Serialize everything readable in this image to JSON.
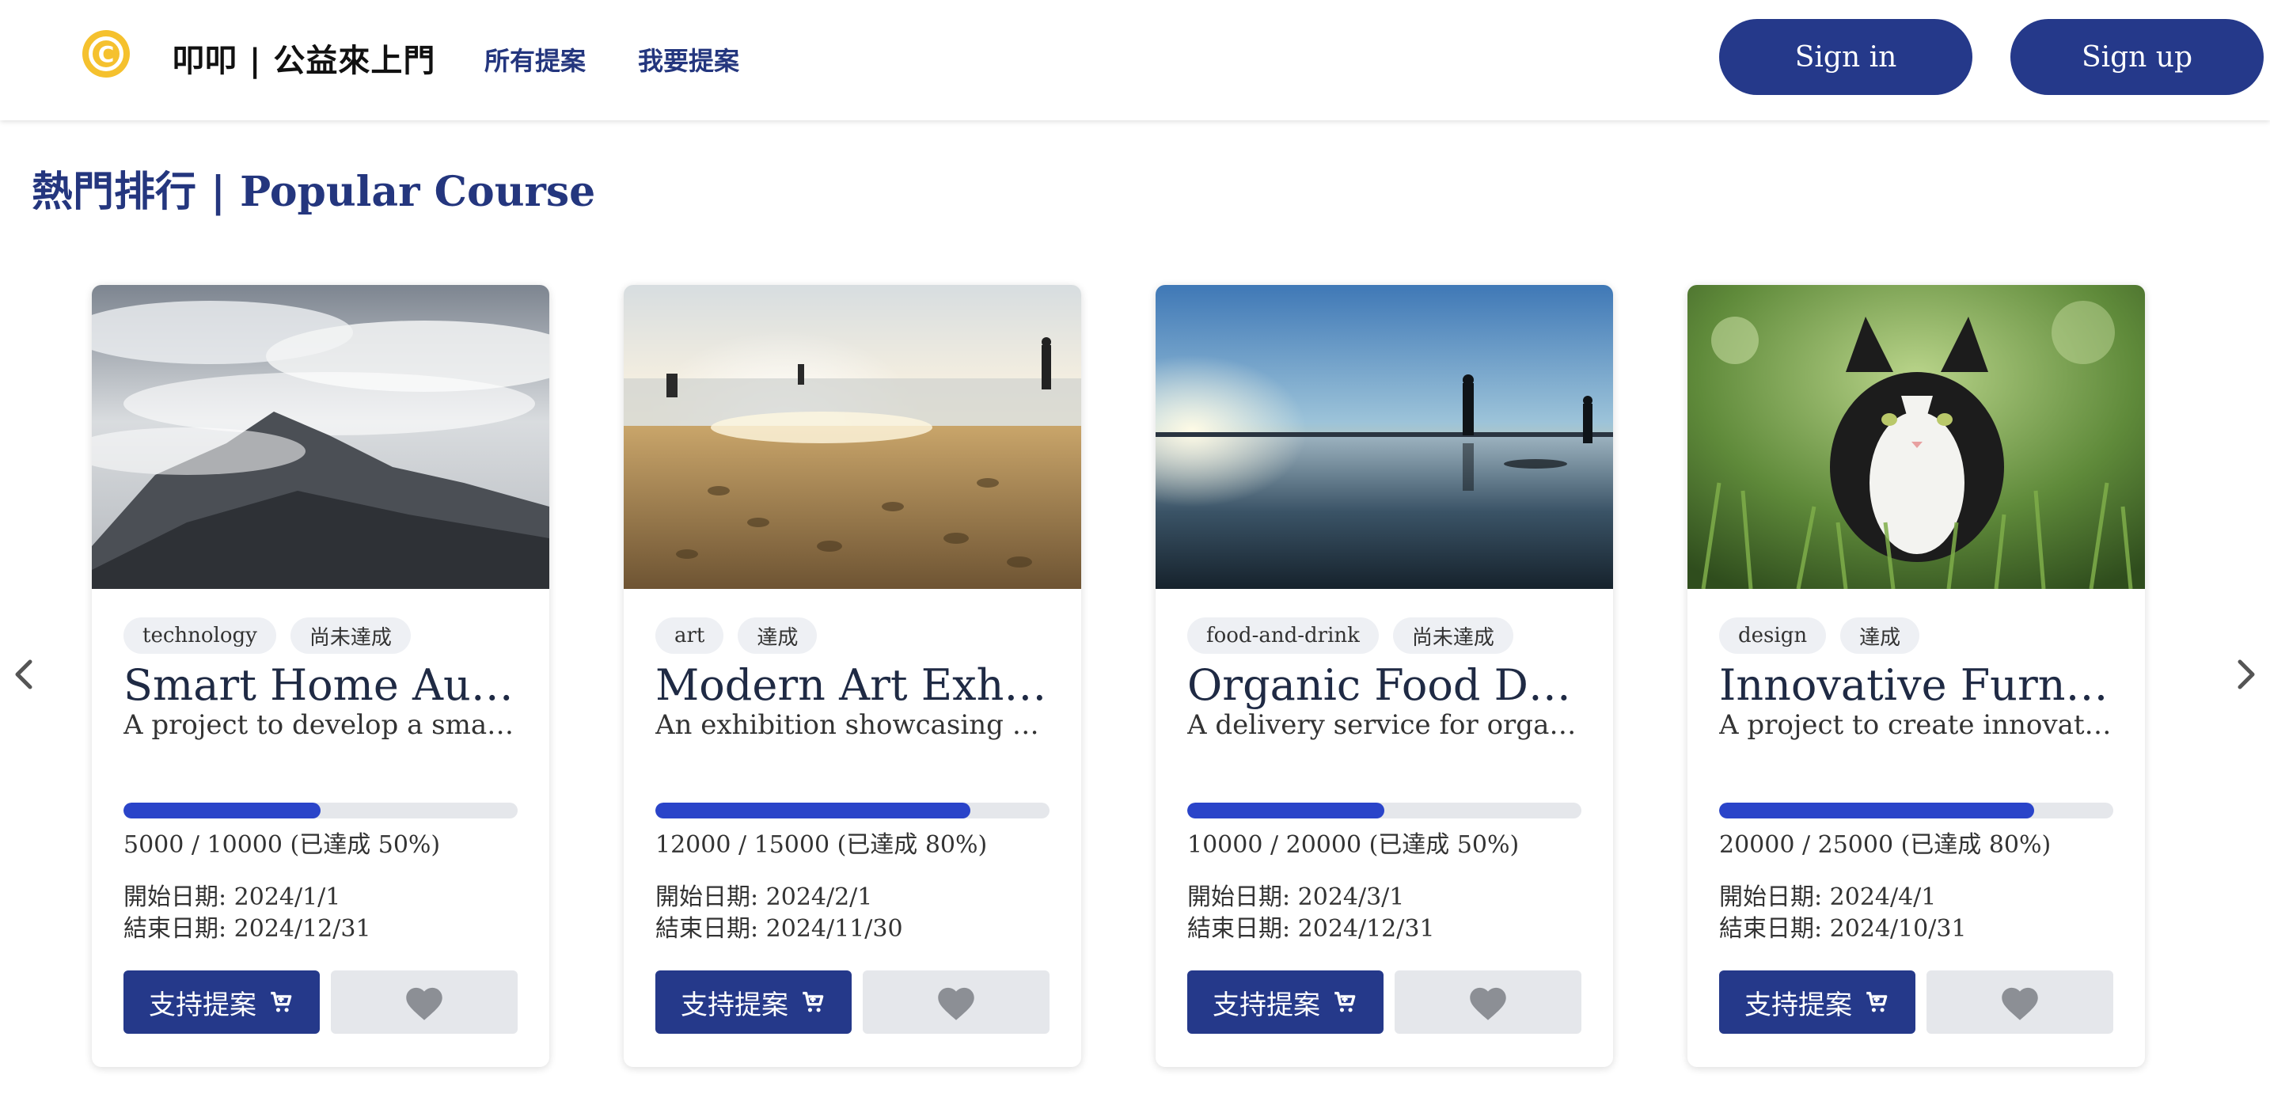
{
  "header": {
    "brand": "叩叩 | 公益來上門",
    "nav": [
      "所有提案",
      "我要提案"
    ],
    "sign_in": "Sign in",
    "sign_up": "Sign up",
    "logo_icon": "copyright-coin-icon",
    "logo_letter": "C"
  },
  "section": {
    "title": "熱門排行 | Popular Course"
  },
  "colors": {
    "primary": "#25398a",
    "progress": "#2a44c9",
    "logo": "#f5c12e",
    "fav": "#e5e7eb"
  },
  "cards": [
    {
      "image": "mountain-clouds",
      "tags": [
        "technology",
        "尚未達成"
      ],
      "title": "Smart Home Automation",
      "desc": "A project to develop a smart home automation system",
      "progress": 0.5,
      "progress_text": "5000 / 10000 (已達成 50%)",
      "start": "開始日期: 2024/1/1",
      "end": "結束日期: 2024/12/31",
      "support": "支持提案"
    },
    {
      "image": "beach-sunset",
      "tags": [
        "art",
        "達成"
      ],
      "title": "Modern Art Exhibition",
      "desc": "An exhibition showcasing modern art",
      "progress": 0.8,
      "progress_text": "12000 / 15000 (已達成 80%)",
      "start": "開始日期: 2024/2/1",
      "end": "結束日期: 2024/11/30",
      "support": "支持提案"
    },
    {
      "image": "sea-sunset-silhouettes",
      "tags": [
        "food-and-drink",
        "尚未達成"
      ],
      "title": "Organic Food Delivery",
      "desc": "A delivery service for organic food",
      "progress": 0.5,
      "progress_text": "10000 / 20000 (已達成 50%)",
      "start": "開始日期: 2024/3/1",
      "end": "結束日期: 2024/12/31",
      "support": "支持提案"
    },
    {
      "image": "cat-in-grass",
      "tags": [
        "design",
        "達成"
      ],
      "title": "Innovative Furniture",
      "desc": "A project to create innovative furniture",
      "progress": 0.8,
      "progress_text": "20000 / 25000 (已達成 80%)",
      "start": "開始日期: 2024/4/1",
      "end": "結束日期: 2024/10/31",
      "support": "支持提案"
    }
  ]
}
